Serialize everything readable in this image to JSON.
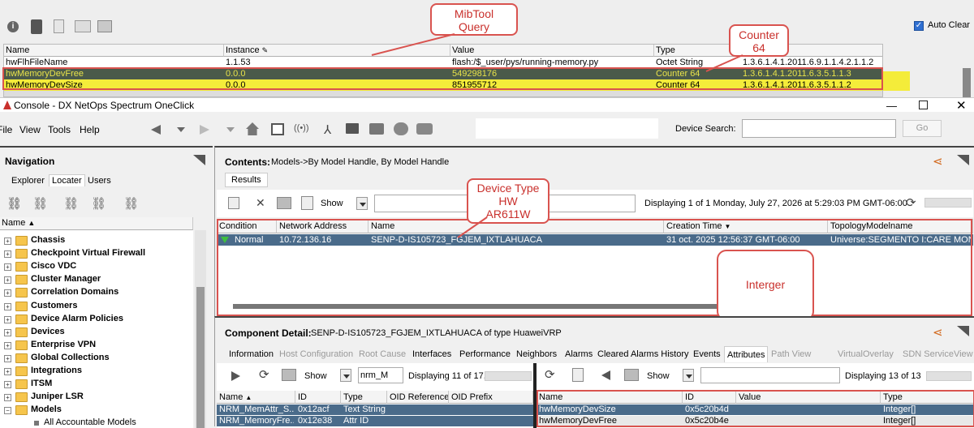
{
  "mib": {
    "columns": [
      "Name",
      "Instance",
      "Value",
      "Type"
    ],
    "rows": [
      {
        "name": "hwFlhFileName",
        "instance": "1.1.53",
        "value": "flash:/$_user/pys/running-memory.py",
        "type": "Octet String",
        "oid": "1.3.6.1.4.1.2011.6.9.1.1.4.2.1.1.2"
      },
      {
        "name": "hwMemoryDevFree",
        "instance": "0.0.0",
        "value": "549298176",
        "type": "Counter 64",
        "oid": "1.3.6.1.4.1.2011.6.3.5.1.1.3"
      },
      {
        "name": "hwMemoryDevSize",
        "instance": "0.0.0",
        "value": "851955712",
        "type": "Counter 64",
        "oid": "1.3.6.1.4.1.2011.6.3.5.1.1.2"
      }
    ],
    "auto_clear_label": "Auto Clear",
    "auto_clear_checked": true
  },
  "annotations": {
    "mibtool": "MibTool\nQuery",
    "counter": "Counter\n64",
    "device_type": "Device Type\nHW\nAR611W",
    "integer": "Interger"
  },
  "window": {
    "title": "Console - DX NetOps Spectrum OneClick",
    "menu": [
      "File",
      "View",
      "Tools",
      "Help"
    ],
    "device_search_label": "Device Search:",
    "device_search_value": "",
    "go_label": "Go"
  },
  "nav": {
    "title": "Navigation",
    "tabs": [
      "Explorer",
      "Locater",
      "Users"
    ],
    "name_header": "Name",
    "items": [
      "Chassis",
      "Checkpoint Virtual Firewall",
      "Cisco VDC",
      "Cluster Manager",
      "Correlation Domains",
      "Customers",
      "Device Alarm Policies",
      "Devices",
      "Enterprise VPN",
      "Global Collections",
      "Integrations",
      "ITSM",
      "Juniper LSR",
      "Models"
    ],
    "sub_item": "All Accountable Models"
  },
  "contents": {
    "label": "Contents:",
    "path": "Models->By Model Handle, By Model Handle",
    "results_tab": "Results",
    "show_label": "Show",
    "display_text": "Displaying 1 of 1 Monday, July 27, 2026 at 5:29:03 PM GMT-06:00",
    "columns": [
      "Condition",
      "Network Address",
      "Name",
      "Creation Time",
      "TopologyModelname"
    ],
    "row": {
      "condition": "Normal",
      "address": "10.72.136.16",
      "name": "SENP-D-IS105723_FGJEM_IXTLAHUACA",
      "created": "31 oct. 2025 12:56:37 GMT-06:00",
      "topology": "Universe:SEGMENTO I:CARE MON"
    }
  },
  "component": {
    "label": "Component Detail:",
    "subtitle": "SENP-D-IS105723_FGJEM_IXTLAHUACA of type HuaweiVRP",
    "tabs": [
      "Information",
      "Host Configuration",
      "Root Cause",
      "Interfaces",
      "Performance",
      "Neighbors",
      "Alarms",
      "Cleared Alarms History",
      "Events",
      "Attributes",
      "Path View",
      "VirtualOverlay",
      "SDN ServiceView"
    ],
    "left": {
      "show_label": "Show",
      "filter_value": "nrm_M",
      "display_text": "Displaying 11 of 17,8",
      "columns": [
        "Name",
        "ID",
        "Type",
        "OID Reference",
        "OID Prefix"
      ],
      "rows": [
        {
          "name": "NRM_MemAttr_S...",
          "id": "0x12acf",
          "type": "Text String"
        },
        {
          "name": "NRM_MemoryFre...",
          "id": "0x12e38",
          "type": "Attr ID"
        }
      ]
    },
    "right": {
      "show_label": "Show",
      "filter_value": "",
      "display_text": "Displaying 13 of 13",
      "columns": [
        "Name",
        "ID",
        "Value",
        "Type"
      ],
      "rows": [
        {
          "name": "hwMemoryDevSize",
          "id": "0x5c20b4d",
          "value": "",
          "type": "Integer[]"
        },
        {
          "name": "hwMemoryDevFree",
          "id": "0x5c20b4e",
          "value": "",
          "type": "Integer[]"
        }
      ]
    }
  }
}
